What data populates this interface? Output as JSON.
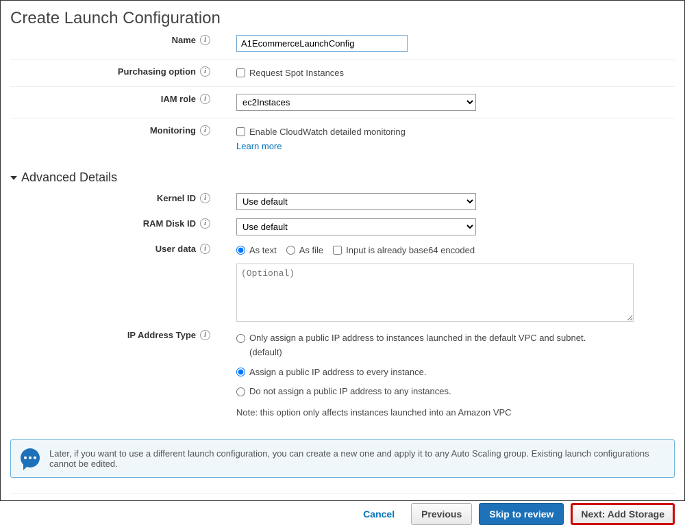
{
  "page_title": "Create Launch Configuration",
  "rows": {
    "name": {
      "label": "Name",
      "value": "A1EcommerceLaunchConfig"
    },
    "purchasing": {
      "label": "Purchasing option",
      "checkbox_label": "Request Spot Instances"
    },
    "iam": {
      "label": "IAM role",
      "selected": "ec2Instaces"
    },
    "monitoring": {
      "label": "Monitoring",
      "checkbox_label": "Enable CloudWatch detailed monitoring",
      "link": "Learn more"
    }
  },
  "advanced_header": "Advanced Details",
  "advanced": {
    "kernel": {
      "label": "Kernel ID",
      "selected": "Use default"
    },
    "ramdisk": {
      "label": "RAM Disk ID",
      "selected": "Use default"
    },
    "userdata": {
      "label": "User data",
      "radio_text": "As text",
      "radio_file": "As file",
      "checkbox_b64": "Input is already base64 encoded",
      "placeholder": "(Optional)"
    },
    "ip": {
      "label": "IP Address Type",
      "opt1": "Only assign a public IP address to instances launched in the default VPC and subnet. (default)",
      "opt2": "Assign a public IP address to every instance.",
      "opt3": "Do not assign a public IP address to any instances.",
      "note": "Note: this option only affects instances launched into an Amazon VPC"
    }
  },
  "info_box": "Later, if you want to use a different launch configuration, you can create a new one and apply it to any Auto Scaling group. Existing launch configurations cannot be edited.",
  "footer": {
    "cancel": "Cancel",
    "previous": "Previous",
    "skip": "Skip to review",
    "next": "Next: Add Storage"
  }
}
